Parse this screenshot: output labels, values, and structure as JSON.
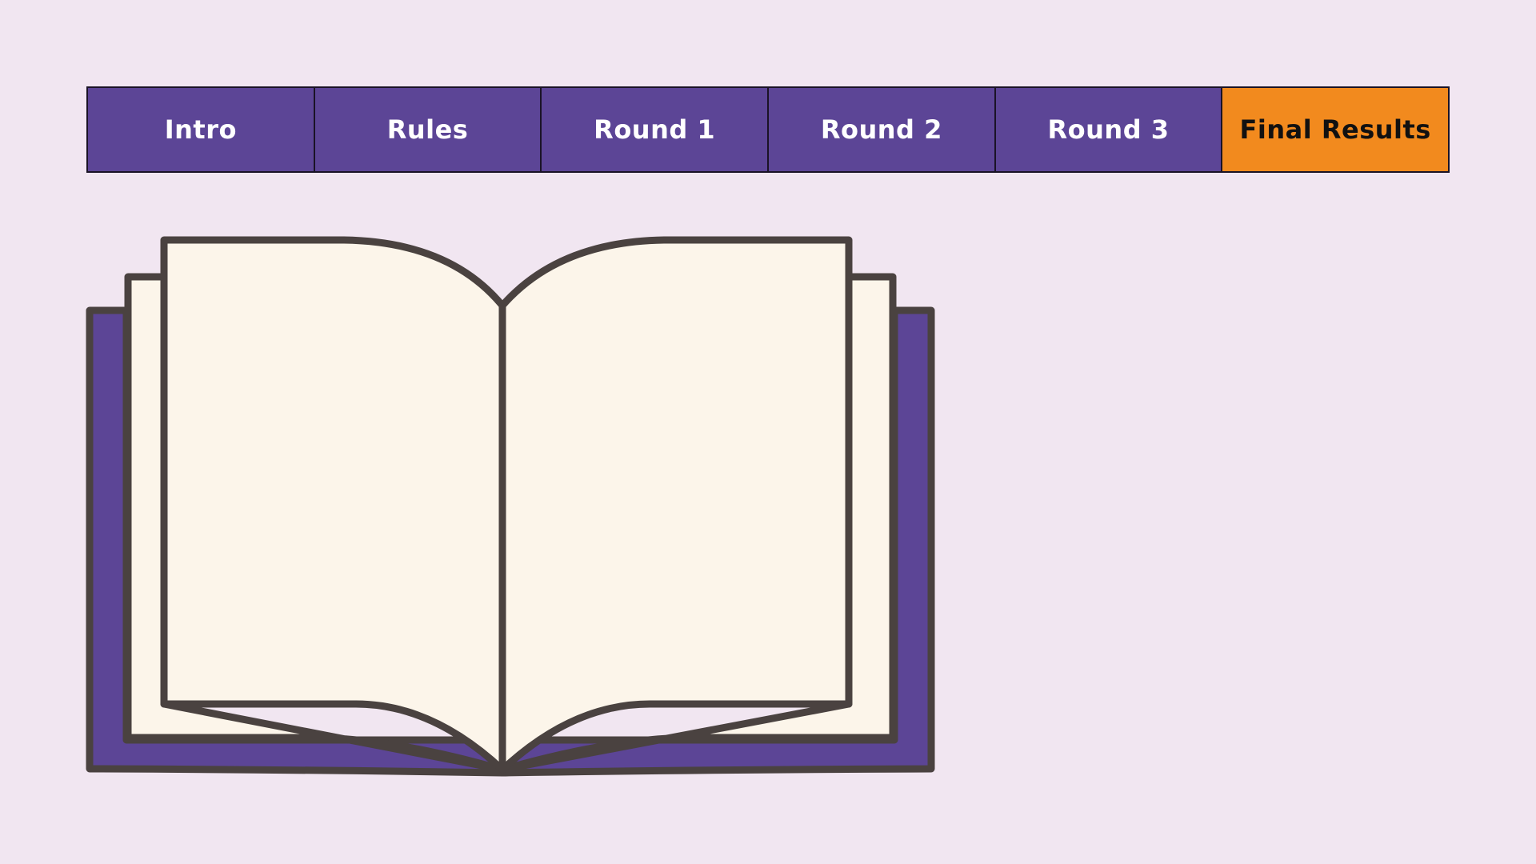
{
  "tabs": [
    {
      "label": "Intro",
      "active": false
    },
    {
      "label": "Rules",
      "active": false
    },
    {
      "label": "Round 1",
      "active": false
    },
    {
      "label": "Round 2",
      "active": false
    },
    {
      "label": "Round 3",
      "active": false
    },
    {
      "label": "Final Results",
      "active": true
    }
  ],
  "colors": {
    "background": "#F1E6F1",
    "tab": "#5C4596",
    "tab_active": "#F28A1E",
    "tab_text": "#FFFFFF",
    "tab_active_text": "#111111",
    "book_cover": "#5C4596",
    "book_page": "#FCF5EA",
    "book_outline": "#4A4240"
  },
  "illustration": {
    "icon": "open-book-icon"
  }
}
